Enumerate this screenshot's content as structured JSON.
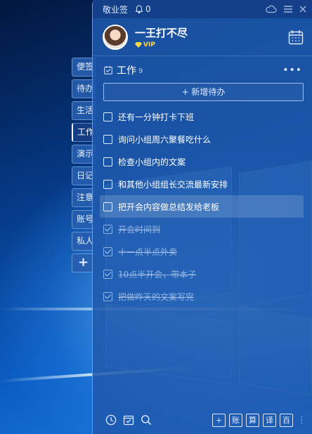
{
  "app": {
    "title": "敬业签",
    "notification_count": "0"
  },
  "user": {
    "name": "一王打不尽",
    "badge": "VIP"
  },
  "tabs": [
    {
      "label": "便签"
    },
    {
      "label": "待办"
    },
    {
      "label": "生活"
    },
    {
      "label": "工作"
    },
    {
      "label": "演示"
    },
    {
      "label": "日记"
    },
    {
      "label": "注意"
    },
    {
      "label": "账号"
    },
    {
      "label": "私人"
    }
  ],
  "add_tab_label": "+",
  "list": {
    "title": "工作",
    "count": "9",
    "more": "•••",
    "add_button": "+ 新增待办"
  },
  "items": [
    {
      "text": "还有一分钟打卡下班",
      "done": false
    },
    {
      "text": "询问小组周六聚餐吃什么",
      "done": false
    },
    {
      "text": "检查小组内的文案",
      "done": false
    },
    {
      "text": "和其他小组组长交流最新安排",
      "done": false
    },
    {
      "text": "把开会内容做总结发给老板",
      "done": false,
      "highlight": true
    },
    {
      "text": "开会时间到",
      "done": true
    },
    {
      "text": "十一点半点外卖",
      "done": true
    },
    {
      "text": "10点半开会，带本子",
      "done": true
    },
    {
      "text": "把做昨天的文案写完",
      "done": true
    }
  ],
  "tools": [
    "+",
    "账",
    "算",
    "译",
    "百"
  ],
  "colors": {
    "panel": "#1e58ac",
    "topbar": "#143e87",
    "vip": "#ffd84a"
  },
  "icons": [
    "bell-icon",
    "cloud-icon",
    "menu-icon",
    "close-icon",
    "calendar-icon",
    "clock-icon",
    "check-note-icon",
    "search-icon"
  ]
}
